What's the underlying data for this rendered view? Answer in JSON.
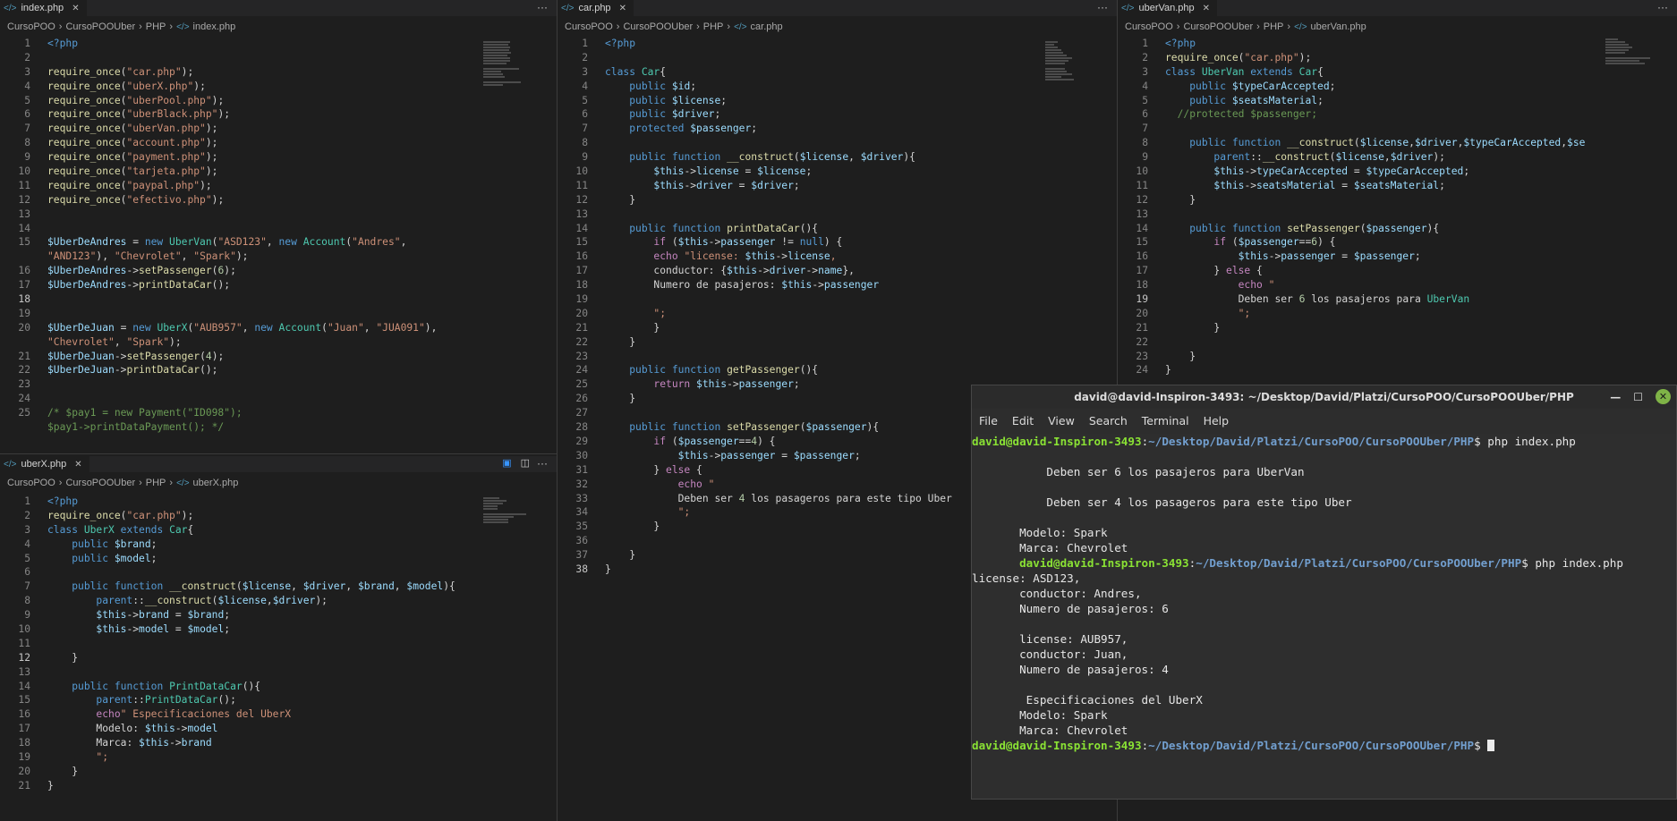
{
  "panes": {
    "index": {
      "tab": "index.php",
      "crumb": [
        "CursoPOO",
        "CursoPOOUber",
        "PHP",
        "index.php"
      ],
      "lines": [
        [
          "<?php"
        ],
        [
          ""
        ],
        [
          "require_once(\"car.php\");"
        ],
        [
          "require_once(\"uberX.php\");"
        ],
        [
          "require_once(\"uberPool.php\");"
        ],
        [
          "require_once(\"uberBlack.php\");"
        ],
        [
          "require_once(\"uberVan.php\");"
        ],
        [
          "require_once(\"account.php\");"
        ],
        [
          "require_once(\"payment.php\");"
        ],
        [
          "require_once(\"tarjeta.php\");"
        ],
        [
          "require_once(\"paypal.php\");"
        ],
        [
          "require_once(\"efectivo.php\");"
        ],
        [
          ""
        ],
        [
          ""
        ],
        [
          "$UberDeAndres = new UberVan(\"ASD123\", new Account(\"Andres\","
        ],
        [
          "\"AND123\"), \"Chevrolet\", \"Spark\");"
        ],
        [
          "$UberDeAndres->setPassenger(6);"
        ],
        [
          "$UberDeAndres->printDataCar();"
        ],
        [
          ""
        ],
        [
          ""
        ],
        [
          "$UberDeJuan = new UberX(\"AUB957\", new Account(\"Juan\", \"JUA091\"),"
        ],
        [
          "\"Chevrolet\", \"Spark\");"
        ],
        [
          "$UberDeJuan->setPassenger(4);"
        ],
        [
          "$UberDeJuan->printDataCar();"
        ],
        [
          ""
        ],
        [
          ""
        ],
        [
          "/* $pay1 = new Payment(\"ID098\");"
        ],
        [
          "$pay1->printDataPayment(); */"
        ]
      ],
      "numbers": [
        "1",
        "2",
        "3",
        "4",
        "5",
        "6",
        "7",
        "8",
        "9",
        "10",
        "11",
        "12",
        "13",
        "14",
        "15",
        "",
        "16",
        "17",
        "18",
        "19",
        "20",
        "",
        "21",
        "22",
        "23",
        "24",
        "25",
        ""
      ]
    },
    "uberx": {
      "tab": "uberX.php",
      "crumb": [
        "CursoPOO",
        "CursoPOOUber",
        "PHP",
        "uberX.php"
      ],
      "lines": [
        "<?php",
        "require_once(\"car.php\");",
        "class UberX extends Car{",
        "    public $brand;",
        "    public $model;",
        "",
        "    public function __construct($license, $driver, $brand, $model){",
        "        parent::__construct($license,$driver);",
        "        $this->brand = $brand;",
        "        $this->model = $model;",
        "",
        "    }",
        "",
        "    public function PrintDataCar(){",
        "        parent::PrintDataCar();",
        "        echo\" Especificaciones del UberX",
        "        Modelo: $this->model",
        "        Marca: $this->brand",
        "        \";",
        "    }",
        "}"
      ]
    },
    "car": {
      "tab": "car.php",
      "crumb": [
        "CursoPOO",
        "CursoPOOUber",
        "PHP",
        "car.php"
      ],
      "lines": [
        "<?php",
        "",
        "class Car{",
        "    public $id;",
        "    public $license;",
        "    public $driver;",
        "    protected $passenger;",
        "",
        "    public function __construct($license, $driver){",
        "        $this->license = $license;",
        "        $this->driver = $driver;",
        "    }",
        "",
        "    public function printDataCar(){",
        "        if ($this->passenger != null) {",
        "        echo \"license: $this->license,",
        "        conductor: {$this->driver->name},",
        "        Numero de pasajeros: $this->passenger",
        "",
        "        \";",
        "        }",
        "    }",
        "",
        "    public function getPassenger(){",
        "        return $this->passenger;",
        "    }",
        "",
        "    public function setPassenger($passenger){",
        "        if ($passenger==4) {",
        "            $this->passenger = $passenger;",
        "        } else {",
        "            echo \"",
        "            Deben ser 4 los pasageros para este tipo Uber",
        "            \";",
        "        }",
        "",
        "    }",
        "}"
      ]
    },
    "ubervan": {
      "tab": "uberVan.php",
      "crumb": [
        "CursoPOO",
        "CursoPOOUber",
        "PHP",
        "uberVan.php"
      ],
      "lines": [
        "<?php",
        "require_once(\"car.php\");",
        "class UberVan extends Car{",
        "    public $typeCarAccepted;",
        "    public $seatsMaterial;",
        "  //protected $passenger;",
        "",
        "    public function __construct($license,$driver,$typeCarAccepted,$se",
        "        parent::__construct($license,$driver);",
        "        $this->typeCarAccepted = $typeCarAccepted;",
        "        $this->seatsMaterial = $seatsMaterial;",
        "    }",
        "",
        "    public function setPassenger($passenger){",
        "        if ($passenger==6) {",
        "            $this->passenger = $passenger;",
        "        } else {",
        "            echo \"",
        "            Deben ser 6 los pasajeros para UberVan",
        "            \";",
        "        }",
        "",
        "    }",
        "}"
      ]
    }
  },
  "terminal": {
    "title": "david@david-Inspiron-3493: ~/Desktop/David/Platzi/CursoPOO/CursoPOOUber/PHP",
    "menu": [
      "File",
      "Edit",
      "View",
      "Search",
      "Terminal",
      "Help"
    ],
    "user": "david@david-Inspiron-3493",
    "path": "~/Desktop/David/Platzi/CursoPOO/CursoPOOUber/PHP",
    "command": "php index.php",
    "output1": [
      "",
      "           Deben ser 6 los pasajeros para UberVan",
      "",
      "           Deben ser 4 los pasageros para este tipo Uber",
      "",
      "       Modelo: Spark",
      "       Marca: Chevrolet"
    ],
    "output2": [
      "license: ASD123,",
      "       conductor: Andres,",
      "       Numero de pasajeros: 6",
      "",
      "       license: AUB957,",
      "       conductor: Juan,",
      "       Numero de pasajeros: 4",
      "",
      "        Especificaciones del UberX",
      "       Modelo: Spark",
      "       Marca: Chevrolet"
    ],
    "prefix_indent": "       "
  }
}
